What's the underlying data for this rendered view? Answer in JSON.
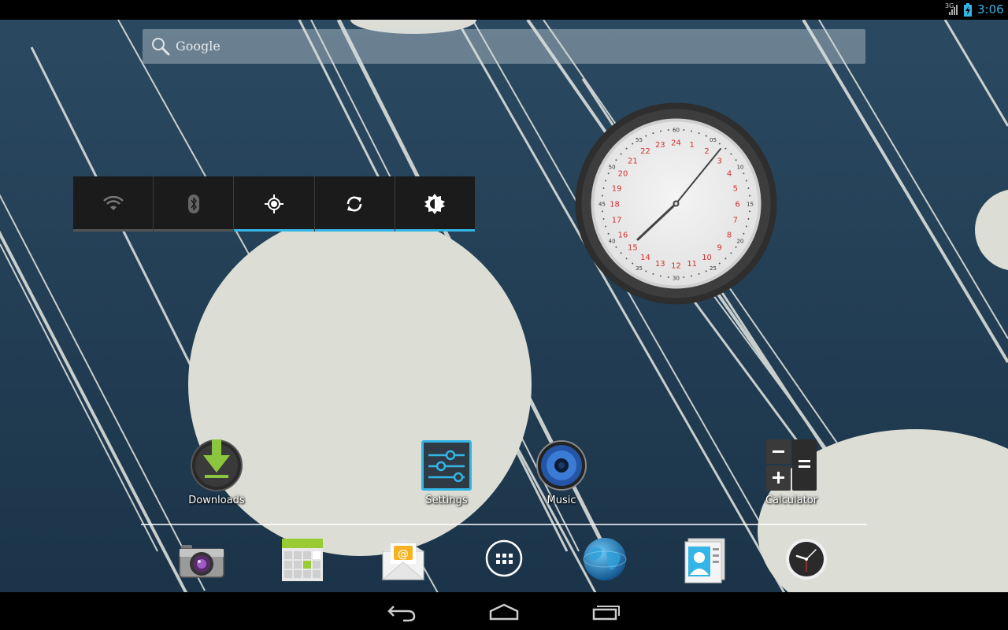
{
  "status_bar": {
    "network_type": "3G",
    "time": "3:06",
    "accent_color": "#33b5e5"
  },
  "search": {
    "label": "Google",
    "icon": "search-icon"
  },
  "power_widget": {
    "toggles": [
      {
        "name": "wifi",
        "icon": "wifi-icon",
        "on": false
      },
      {
        "name": "bluetooth",
        "icon": "bluetooth-icon",
        "on": false
      },
      {
        "name": "gps",
        "icon": "gps-icon",
        "on": true
      },
      {
        "name": "sync",
        "icon": "sync-icon",
        "on": true
      },
      {
        "name": "brightness",
        "icon": "brightness-icon",
        "on": true
      }
    ]
  },
  "clock_widget": {
    "outer_numbers": [
      "60",
      "05",
      "10",
      "15",
      "20",
      "25",
      "30",
      "35",
      "40",
      "45",
      "50",
      "55"
    ],
    "hour_numbers": [
      "24",
      "1",
      "2",
      "3",
      "4",
      "5",
      "6",
      "7",
      "8",
      "9",
      "10",
      "11",
      "12",
      "13",
      "14",
      "15",
      "16",
      "17",
      "18",
      "19",
      "20",
      "21",
      "22",
      "23"
    ]
  },
  "shortcuts": {
    "downloads": "Downloads",
    "settings": "Settings",
    "music": "Music",
    "calculator": "Calculator"
  },
  "dock": [
    {
      "name": "camera",
      "icon": "camera-icon"
    },
    {
      "name": "calendar",
      "icon": "calendar-icon"
    },
    {
      "name": "email",
      "icon": "email-icon"
    },
    {
      "name": "all-apps",
      "icon": "all-apps-icon"
    },
    {
      "name": "browser",
      "icon": "globe-icon"
    },
    {
      "name": "people",
      "icon": "contacts-icon"
    },
    {
      "name": "clock",
      "icon": "clock-icon"
    }
  ],
  "nav_bar": {
    "buttons": [
      "back",
      "home",
      "recent-apps"
    ]
  }
}
